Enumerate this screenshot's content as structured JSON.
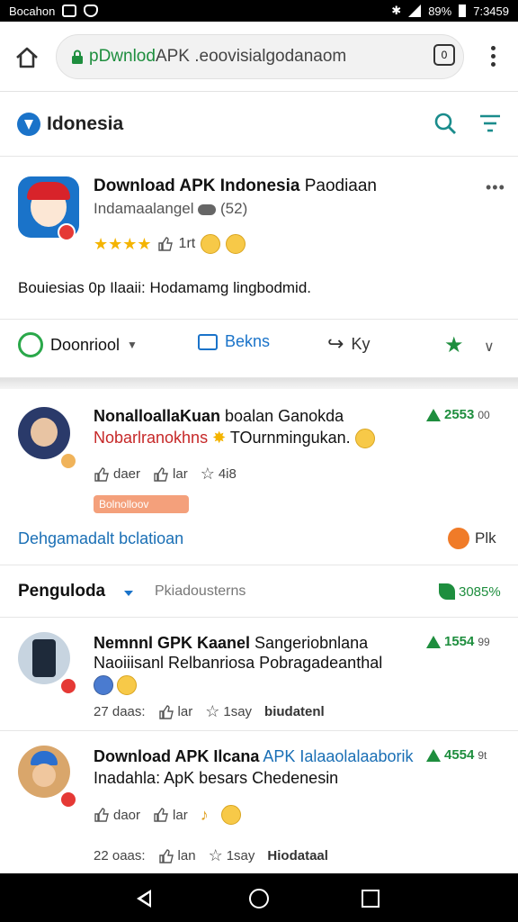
{
  "status_bar": {
    "left_text": "Bocahon",
    "battery": "89%",
    "time": "7:3459"
  },
  "browser": {
    "url_prefix": "p",
    "url_green": "Dwnlod",
    "url_rest": " APK .eoovisialgodanaom",
    "tabs_count": "0"
  },
  "app_header": {
    "title": "Idonesia"
  },
  "featured": {
    "title_bold": "Download APK Indonesia",
    "title_rest": " Paodiaan",
    "subtitle": "Indamaalangel",
    "subtitle_count": "(52)",
    "rating_stars": 3.5,
    "rating_text": "1rt",
    "description": "Bouiesias 0p Ilaaii: Hodamamg lingbodmid.",
    "actions": {
      "download_label": "Doonriool",
      "comments_label": "Bekns",
      "share_label": "Ky"
    }
  },
  "post1": {
    "title_bold": "NonalloallaKuan",
    "title_rest": " boalan Ganokda",
    "line2_red": "Nobarlranokhns",
    "line2_rest": " TOurnmingukan.",
    "metric_value": "2553",
    "metric_sub": "00",
    "react_like": "daer",
    "react_up": "lar",
    "react_star": "4i8",
    "tag": "Bolnolloov",
    "link_text": "Dehgamadalt bclatioan",
    "rk_label": "Plk"
  },
  "section": {
    "title": "Penguloda",
    "filter": "Pkiadousterns",
    "percent": "3085%"
  },
  "post2": {
    "title_bold": "Nemnnl GPK Kaanel",
    "title_rest": " Sangeriobnlana",
    "line2": "Naoiiisanl Relbanriosa Pobragadeanthal",
    "metric_value": "1554",
    "metric_sub": "99",
    "meta_days": "27 daas:",
    "react_up": "lar",
    "react_star": "1say",
    "react_tag": "biudatenl"
  },
  "post3": {
    "title_bold": "Download APK Ilcana",
    "title_blue": " APK Ialaaolalaaborik",
    "line2": "Inadahla: ApK besars Chedenesin",
    "metric_value": "4554",
    "metric_sub": "9t",
    "react_like": "daor",
    "react_up": "lar",
    "meta_days": "22 oaas:",
    "react_up2": "lan",
    "react_star": "1say",
    "react_tag": "Hiodataal"
  },
  "colors": {
    "accent_blue": "#1a73c9",
    "green": "#1e8e3e",
    "star": "#f4b400",
    "red": "#e53935"
  }
}
